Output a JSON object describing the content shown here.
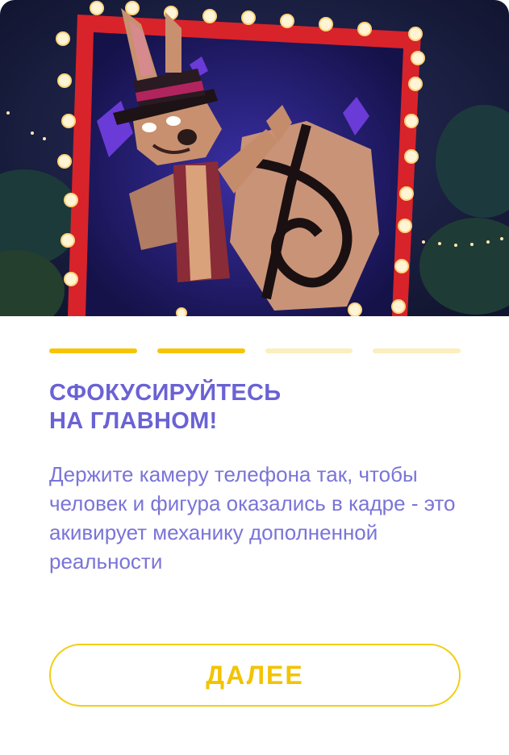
{
  "onboarding": {
    "title_line1": "СФОКУСИРУЙТЕСЬ",
    "title_line2": "НА ГЛАВНОМ!",
    "description": "Держите камеру телефона так, чтобы человек и фигура оказались в кадре - это акивирует механику дополненной реальности",
    "next_label": "ДАЛЕЕ",
    "progress": {
      "total_steps": 4,
      "active_steps": 2
    }
  },
  "colors": {
    "title": "#6a62d4",
    "text": "#7a74d8",
    "accent": "#f6c500",
    "accent_inactive": "#fbefbe",
    "frame": "#e0262c"
  },
  "hero": {
    "icon": "rabbit-magician-illustration"
  }
}
